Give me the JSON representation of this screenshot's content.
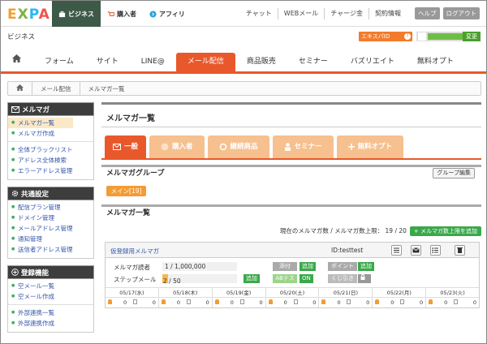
{
  "header": {
    "logo": [
      "E",
      "X",
      "P",
      "A"
    ],
    "tabs": [
      {
        "label": "ビジネス",
        "icon": "briefcase-icon",
        "active": true
      },
      {
        "label": "購入者",
        "icon": "cart-icon",
        "active": false
      },
      {
        "label": "アフィリ",
        "icon": "circle-arrow-icon",
        "active": false
      }
    ],
    "links": [
      "チャット",
      "WEBメール",
      "チャージ金",
      "契約情報"
    ],
    "help": "ヘルプ",
    "logout": "ログアウト"
  },
  "subheader": {
    "title": "ビジネス",
    "ekisu_label": "エキスパID",
    "ekisu_help": "?",
    "change_label": "変更"
  },
  "mainnav": {
    "items": [
      "フォーム",
      "サイト",
      "LINE@",
      "メール配信",
      "商品販売",
      "セミナー",
      "バズリエイト",
      "無料オプト"
    ],
    "active": "メール配信"
  },
  "breadcrumb": [
    "メール配信",
    "メルマガ一覧"
  ],
  "sidebar": {
    "sections": [
      {
        "title": "メルマガ",
        "icon": "mail-icon",
        "groups": [
          [
            "メルマガ一覧",
            "メルマガ作成"
          ],
          [
            "全体ブラックリスト",
            "アドレス全体検索",
            "エラーアドレス管理"
          ]
        ]
      },
      {
        "title": "共通設定",
        "icon": "gear-icon",
        "groups": [
          [
            "配信プラン管理",
            "ドメイン管理",
            "メールアドレス管理",
            "通知管理",
            "送信者アドレス管理"
          ]
        ]
      },
      {
        "title": "登録機能",
        "icon": "plus-circle-icon",
        "groups": [
          [
            "空メール一覧",
            "空メール作成"
          ],
          [
            "外部連携一覧",
            "外部連携作成"
          ]
        ]
      }
    ],
    "active_item": "メルマガ一覧"
  },
  "content": {
    "title": "メルマガ一覧",
    "tabs": [
      {
        "label": "一般",
        "icon": "envelope-icon",
        "active": true
      },
      {
        "label": "購入者",
        "icon": "cart-icon",
        "active": false
      },
      {
        "label": "継続商品",
        "icon": "refresh-icon",
        "active": false
      },
      {
        "label": "セミナー",
        "icon": "person-icon",
        "active": false
      },
      {
        "label": "無料オプト",
        "icon": "plus-icon",
        "active": false
      }
    ],
    "group_section": "メルマガグループ",
    "group_edit_label": "グループ編集",
    "main_group_label": "メイン[19]",
    "list_section": "メルマガ一覧",
    "count_text": "現在のメルマガ数 / メルマガ数上限： 19 / 20",
    "add_limit_label": "メルマガ数上限を追加",
    "card": {
      "name": "仮登録用メルマガ",
      "id": "ID:testtest",
      "readers_label": "メルマガ読者",
      "readers_value": "1 / 1,000,000",
      "step_label": "ステップメール",
      "step_value": "2 / 50",
      "add_label": "追加",
      "attach_label": "添付",
      "point_label": "ポイント",
      "ab_label": "ABテスト",
      "on_label": "ON",
      "lottery_label": "くじ引き",
      "days": [
        "05/17(水)",
        "05/18(木)",
        "05/19(金)",
        "05/20(土)",
        "05/21(日)",
        "05/22(月)",
        "05/23(火)"
      ],
      "day_values": [
        [
          "0",
          "0"
        ],
        [
          "0",
          "0"
        ],
        [
          "0",
          "0"
        ],
        [
          "0",
          "0"
        ],
        [
          "0",
          "0"
        ],
        [
          "0",
          "0"
        ],
        [
          "0",
          "0"
        ]
      ]
    }
  }
}
